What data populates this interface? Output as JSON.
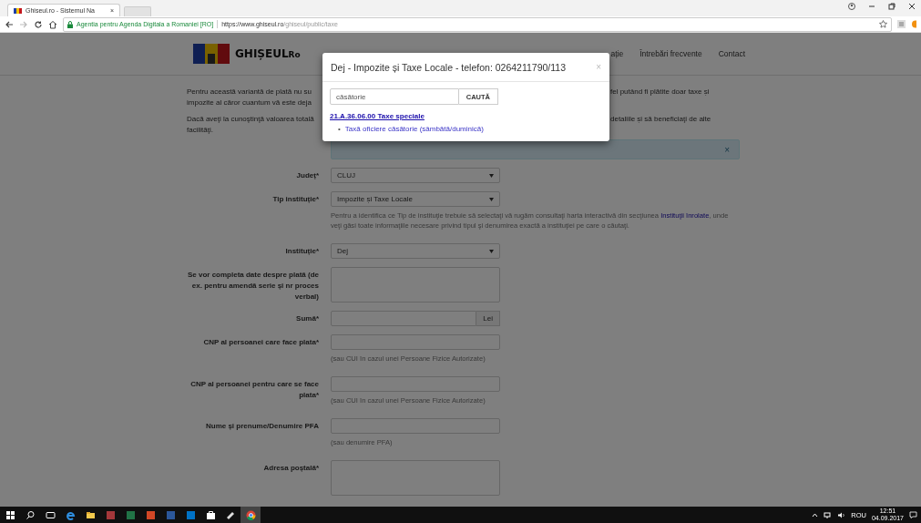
{
  "browser": {
    "tab": {
      "title": "Ghiseul.ro - Sistemul Na",
      "close": "×"
    },
    "address": {
      "site": "Agentia pentru Agenda Digitala a Romaniei [RO]",
      "url_host": "https://www.ghiseul.ro",
      "url_path": "/ghiseul/public/taxe"
    }
  },
  "page": {
    "logo_text": "GHIȘEUL",
    "logo_suffix": "Ro",
    "nav": [
      "ație",
      "Întrebări frecvente",
      "Contact"
    ],
    "intro": [
      {
        "left": [
          "Pentru această variantă de plată nu su",
          "impozite al căror cuantum vă este deja"
        ],
        "right": [
          "fel putând fi plătite doar taxe și"
        ]
      },
      {
        "left": [
          "Dacă aveţi la cunoştinţă valoarea totală",
          "facilităţi."
        ],
        "right": [
          "detaliile și să beneficiaţi de alte"
        ]
      }
    ],
    "alert": {
      "close": "×"
    },
    "fields": [
      {
        "kind": "select",
        "label": "Județ*",
        "value": "CLUJ"
      },
      {
        "kind": "select",
        "label": "Tip instituție*",
        "value": "Impozite și Taxe Locale",
        "hint": "Pentru a identifica ce Tip de instituţie trebuie să selectaţi vă rugăm consultaţi harta interactivă din secţiunea ",
        "hint_link": "Instituţii înrolate",
        "hint_after": ", unde veţi găsi toate informaţiile necesare privind tipul şi denumirea exactă a instituţiei pe care o căutaţi."
      },
      {
        "kind": "select",
        "label": "Instituție*",
        "value": "Dej"
      },
      {
        "kind": "textarea",
        "label": "Se vor completa date despre plată (de ex. pentru amendă serie și nr proces verbal)"
      },
      {
        "kind": "addon",
        "label": "Sumă*",
        "addon": "Lei"
      },
      {
        "kind": "input",
        "label": "CNP al persoanei care face plata*",
        "hint": "(sau CUI în cazul unei Persoane Fizice Autorizate)"
      },
      {
        "kind": "input",
        "label": "CNP al persoanei pentru care se face plata*",
        "hint": "(sau CUI în cazul unei Persoane Fizice Autorizate)"
      },
      {
        "kind": "input",
        "label": "Nume și prenume/Denumire PFA",
        "hint": "(sau denumire PFA)"
      },
      {
        "kind": "textarea",
        "label": "Adresa poștală*"
      }
    ]
  },
  "modal": {
    "title": "Dej - Impozite și Taxe Locale - telefon: 0264211790/113",
    "close": "×",
    "search_value": "căsătorie",
    "search_button": "CAUTĂ",
    "result_heading": "21.A.36.06.00 Taxe speciale",
    "results": [
      {
        "bullet": "•",
        "text": "Taxă oficiere căsătorie (sâmbătă/duminică)"
      }
    ]
  },
  "taskbar": {
    "apps": [
      {
        "kind": "windows",
        "selected": false
      },
      {
        "kind": "search",
        "selected": false
      },
      {
        "kind": "taskview",
        "selected": false
      },
      {
        "kind": "edge",
        "selected": false
      },
      {
        "kind": "explorer",
        "selected": false
      },
      {
        "kind": "access",
        "selected": false
      },
      {
        "kind": "excel",
        "selected": false
      },
      {
        "kind": "powerpoint",
        "selected": false
      },
      {
        "kind": "word",
        "selected": false
      },
      {
        "kind": "outlook",
        "selected": false
      },
      {
        "kind": "store",
        "selected": false
      },
      {
        "kind": "paint",
        "selected": false
      },
      {
        "kind": "chrome",
        "selected": true
      }
    ],
    "language": "ROU",
    "time": "12:51",
    "date": "04.09.2017"
  }
}
